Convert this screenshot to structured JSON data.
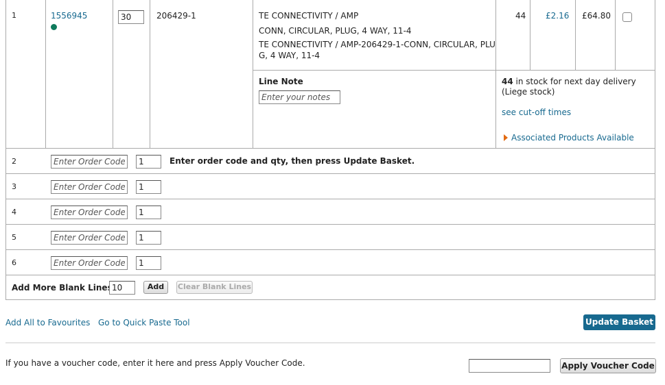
{
  "line1": {
    "number": "1",
    "order_code": "1556945",
    "qty": "30",
    "part_number": "206429-1",
    "manufacturer": "TE CONNECTIVITY / AMP",
    "description": "CONN, CIRCULAR, PLUG, 4 WAY, 11-4",
    "full_desc_line1": "TE CONNECTIVITY / AMP-206429-1-CONN, CIRCULAR, PLU",
    "full_desc_line2": "G, 4 WAY, 11-4",
    "stock": "44",
    "unit_price": "£2.16",
    "line_price": "£64.80",
    "line_note_label": "Line Note",
    "line_note_placeholder": "Enter your notes",
    "stock_count": "44",
    "stock_text_1": " in stock for next day delivery",
    "stock_text_2": "(Liege stock)",
    "cutoff_link": "see cut-off times",
    "associated_link": "Associated Products Available"
  },
  "blank_lines": [
    {
      "number": "2",
      "placeholder": "Enter Order Code",
      "qty": "1",
      "hint": "Enter order code and qty, then press Update Basket."
    },
    {
      "number": "3",
      "placeholder": "Enter Order Code",
      "qty": "1",
      "hint": ""
    },
    {
      "number": "4",
      "placeholder": "Enter Order Code",
      "qty": "1",
      "hint": ""
    },
    {
      "number": "5",
      "placeholder": "Enter Order Code",
      "qty": "1",
      "hint": ""
    },
    {
      "number": "6",
      "placeholder": "Enter Order Code",
      "qty": "1",
      "hint": ""
    }
  ],
  "add_more": {
    "label": "Add More Blank Lines",
    "value": "10",
    "add_button": "Add",
    "clear_button": "Clear Blank Lines"
  },
  "actions": {
    "add_favourites": "Add All to Favourites",
    "quick_paste": "Go to Quick Paste Tool",
    "update_basket": "Update Basket"
  },
  "voucher": {
    "text": "If you have a voucher code, enter it here and press Apply Voucher Code.",
    "value": "",
    "apply_button": "Apply Voucher Code"
  }
}
